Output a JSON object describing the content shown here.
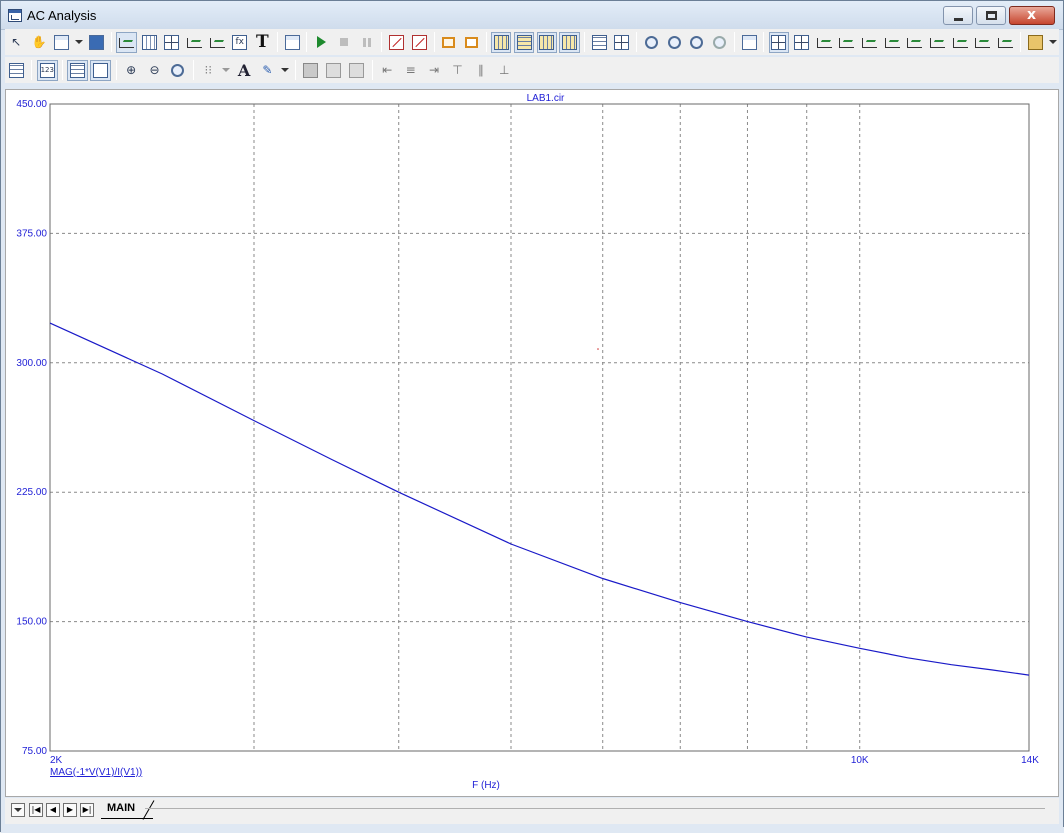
{
  "window": {
    "title": "AC Analysis",
    "minimize_label": "",
    "maximize_label": "",
    "close_label": "x"
  },
  "toolbar1": {
    "icons": [
      "select-arrow-icon",
      "pan-hand-icon",
      "copy-icon",
      "image-icon",
      "scale-icon",
      "grid-icon",
      "cursor-mode-icon",
      "scope-icon",
      "axis-icon",
      "label-icon",
      "text-icon",
      "properties-icon",
      "run-icon",
      "stop-icon",
      "pause-icon",
      "graph-select-icon",
      "graph-delete-icon",
      "tokens-icon",
      "data-points-icon",
      "horizontal-axis-grid-icon",
      "vertical-axis-grid-icon",
      "bar-icon",
      "tall-bar-icon",
      "horizontal-cursor-icon",
      "vertical-cursor-icon",
      "peak-icon",
      "valley-icon",
      "high-icon",
      "low-icon",
      "inflection-icon",
      "slope-icon",
      "global-high-icon",
      "global-low-icon",
      "top-icon",
      "bottom-icon",
      "clipboard-icon"
    ]
  },
  "toolbar2": {
    "text_tool": "T",
    "font_tool": "A"
  },
  "plot": {
    "heading": "LAB1.cir",
    "trace_label": "MAG(-1*V(V1)/I(V1))",
    "x_axis_label": "F (Hz)",
    "y_ticks": [
      "450.00",
      "375.00",
      "300.00",
      "225.00",
      "150.00",
      "75.00"
    ],
    "x_tick_labels": {
      "start": "2K",
      "mid": "10K",
      "end": "14K"
    }
  },
  "chart_data": {
    "type": "line",
    "title": "LAB1.cir",
    "xlabel": "F (Hz)",
    "ylabel": "",
    "xscale": "log",
    "xlim": [
      2000,
      14000
    ],
    "ylim": [
      75,
      450
    ],
    "grid": true,
    "colors": {
      "trace": "#1a1ac8",
      "grid": "#8a8a8a",
      "text": "#1f1fd6"
    },
    "series": [
      {
        "name": "MAG(-1*V(V1)/I(V1))",
        "x": [
          2000,
          2500,
          3000,
          3500,
          4000,
          5000,
          6000,
          7000,
          8000,
          9000,
          10000,
          11000,
          12000,
          13000,
          14000
        ],
        "y": [
          323,
          293.5,
          266.5,
          244,
          225,
          195,
          175,
          161,
          150,
          141,
          134.5,
          129,
          125,
          122,
          119
        ]
      }
    ]
  },
  "bottom": {
    "tab_label": "MAIN",
    "nav": [
      "|◀",
      "◀",
      "▶",
      "▶|"
    ]
  }
}
